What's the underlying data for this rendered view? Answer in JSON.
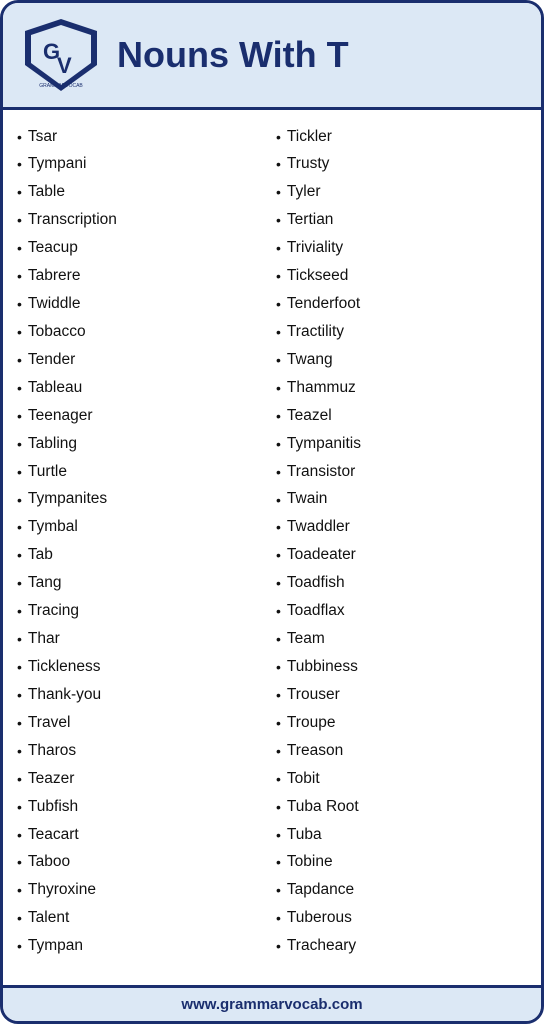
{
  "header": {
    "title": "Nouns With T",
    "logo_text": "GRAMMARVOCAB"
  },
  "columns": {
    "left": [
      "Tsar",
      "Tympani",
      "Table",
      "Transcription",
      "Teacup",
      "Tabrere",
      "Twiddle",
      "Tobacco",
      "Tender",
      "Tableau",
      "Teenager",
      "Tabling",
      "Turtle",
      "Tympanites",
      "Tymbal",
      "Tab",
      "Tang",
      "Tracing",
      "Thar",
      "Tickleness",
      "Thank-you",
      "Travel",
      "Tharos",
      "Teazer",
      "Tubfish",
      "Teacart",
      "Taboo",
      "Thyroxine",
      "Talent",
      "Tympan"
    ],
    "right": [
      "Tickler",
      "Trusty",
      "Tyler",
      "Tertian",
      "Triviality",
      "Tickseed",
      "Tenderfoot",
      "Tractility",
      "Twang",
      "Thammuz",
      "Teazel",
      "Tympanitis",
      "Transistor",
      "Twain",
      "Twaddler",
      "Toadeater",
      "Toadfish",
      "Toadflax",
      "Team",
      "Tubbiness",
      "Trouser",
      "Troupe",
      "Treason",
      "Tobit",
      "Tuba Root",
      "Tuba",
      "Tobine",
      "Tapdance",
      "Tuberous",
      "Tracheary"
    ]
  },
  "footer": {
    "url": "www.grammarvocab.com"
  },
  "bullet": "•"
}
